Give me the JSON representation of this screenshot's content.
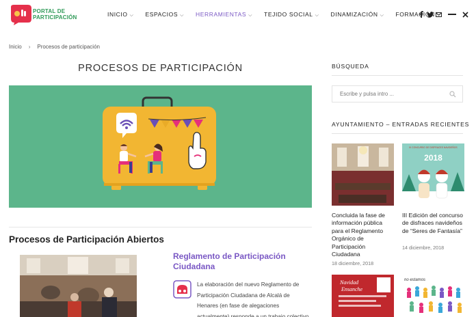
{
  "header": {
    "logo": {
      "line1": "PORTAL DE",
      "line2": "PARTICIPACIÓN"
    },
    "nav": [
      {
        "label": "INICIO",
        "active": false
      },
      {
        "label": "ESPACIOS",
        "active": false
      },
      {
        "label": "HERRAMIENTAS",
        "active": true
      },
      {
        "label": "TEJIDO SOCIAL",
        "active": false
      },
      {
        "label": "DINAMIZACIÓN",
        "active": false
      },
      {
        "label": "FORMACIÓN",
        "active": false
      }
    ],
    "icons": [
      "facebook-icon",
      "twitter-icon",
      "mail-icon",
      "menu-icon",
      "close-icon"
    ]
  },
  "breadcrumb": {
    "home": "Inicio",
    "current": "Procesos de participación"
  },
  "main": {
    "title": "PROCESOS DE PARTICIPACIÓN",
    "section_title": "Procesos de Participación Abiertos",
    "post": {
      "title": "Reglamento de Participación Ciudadana",
      "excerpt": "La elaboración del nuevo Reglamento de Participación Ciudadana de Alcalá de Henares (en fase de alegaciones actualmente) responde a un trabajo colectivo, en el"
    }
  },
  "sidebar": {
    "search_heading": "BÚSQUEDA",
    "search_placeholder": "Escribe y pulsa intro ...",
    "recent_heading": "AYUNTAMIENTO – ENTRADAS RECIENTES",
    "recent": [
      {
        "title": "Concluida la fase de información pública para el Reglamento Orgánico de Participación Ciudadana",
        "date": "18 diciembre, 2018"
      },
      {
        "title": "III Edición del concurso de disfraces navideños de “Seres de Fantasía”",
        "date": "14 diciembre, 2018"
      }
    ],
    "poster_text": {
      "year": "2018",
      "line1": "III CONCURSO DE DISFRACES NAVIDEÑOS",
      "navidad": "Navidad",
      "ensanche": "Ensanche",
      "note": "no estamos"
    }
  },
  "colors": {
    "accent": "#7a58c4",
    "brand_green": "#2f9a58",
    "hero_bg": "#5cb58b",
    "suitcase": "#f2b632"
  }
}
